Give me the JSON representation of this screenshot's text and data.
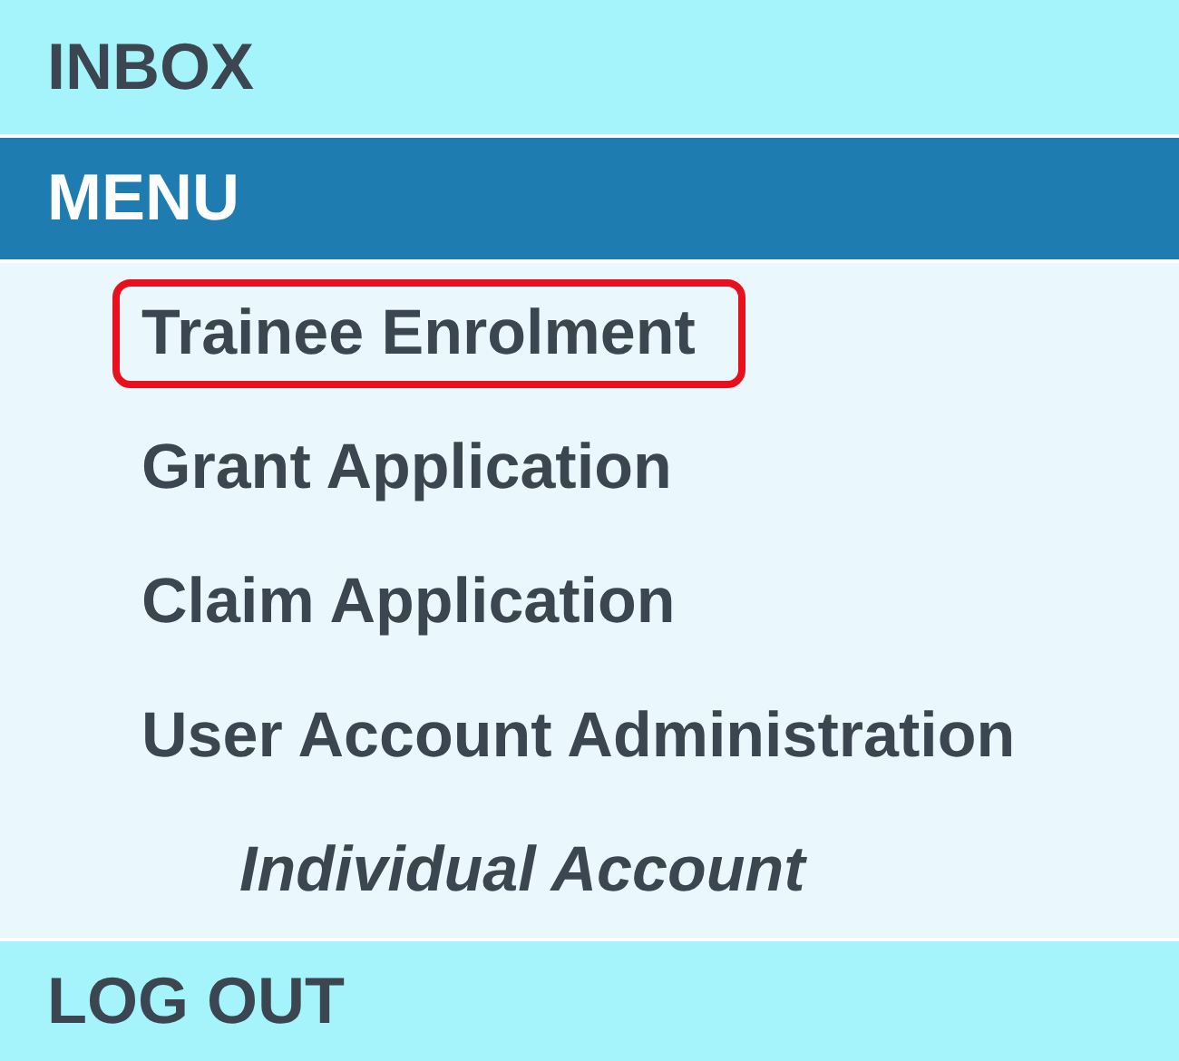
{
  "nav": [
    {
      "kind": "header",
      "label": "INBOX",
      "selected": false
    },
    {
      "kind": "header",
      "label": "MENU",
      "selected": true,
      "items": [
        {
          "label": "Trainee Enrolment",
          "highlighted": true
        },
        {
          "label": "Grant Application",
          "highlighted": false
        },
        {
          "label": "Claim Application",
          "highlighted": false
        },
        {
          "label": "User Account Administration",
          "highlighted": false,
          "children": [
            {
              "label": "Individual Account",
              "highlighted": false
            }
          ]
        }
      ]
    },
    {
      "kind": "header",
      "label": "LOG OUT",
      "selected": false
    }
  ]
}
